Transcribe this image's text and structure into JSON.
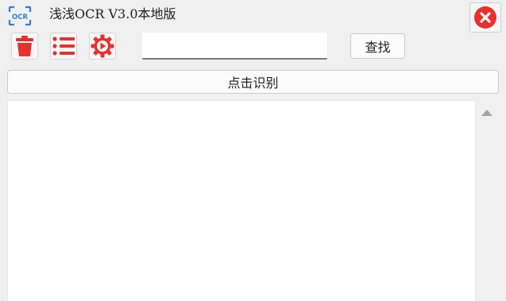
{
  "app": {
    "logo_text": "OCR",
    "title": "浅浅OCR V3.0本地版"
  },
  "toolbar": {
    "icons": [
      "trash-icon",
      "list-icon",
      "settings-icon"
    ],
    "search_value": "",
    "find_label": "查找"
  },
  "recognize_label": "点击识别",
  "result_text": "",
  "colors": {
    "accent_red": "#e8302e",
    "logo_blue": "#2f7fd6",
    "background": "#f0f0f0"
  }
}
